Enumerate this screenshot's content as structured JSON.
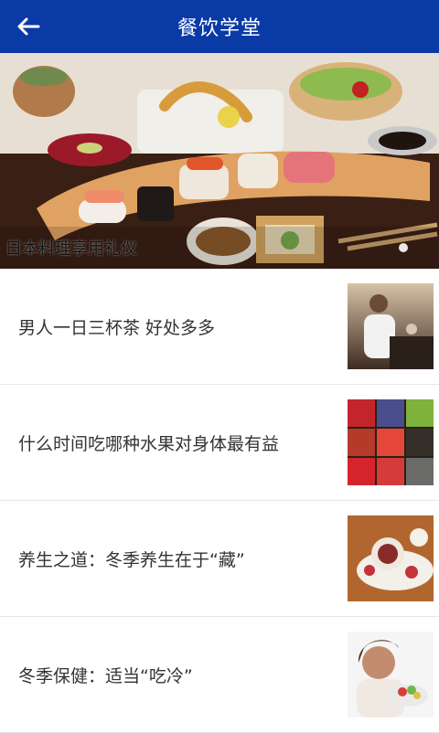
{
  "header": {
    "title": "餐饮学堂",
    "back_icon": "back-arrow-icon"
  },
  "banner": {
    "caption": "日本料理享用礼仪",
    "image": "sushi-platter-photo",
    "pager": {
      "current": 1,
      "total": 1
    }
  },
  "articles": [
    {
      "title": "男人一日三杯茶 好处多多",
      "thumbnail": "man-drinking-tea-photo"
    },
    {
      "title": "什么时间吃哪种水果对身体最有益",
      "thumbnail": "fruit-grid-photo"
    },
    {
      "title": "养生之道：冬季养生在于“藏”",
      "thumbnail": "winter-dessert-photo"
    },
    {
      "title": "冬季保健：适当“吃冷”",
      "thumbnail": "woman-eating-salad-photo"
    }
  ],
  "colors": {
    "appbar": "#0a3aa6",
    "text": "#333333",
    "divider": "#e6e6e6"
  }
}
